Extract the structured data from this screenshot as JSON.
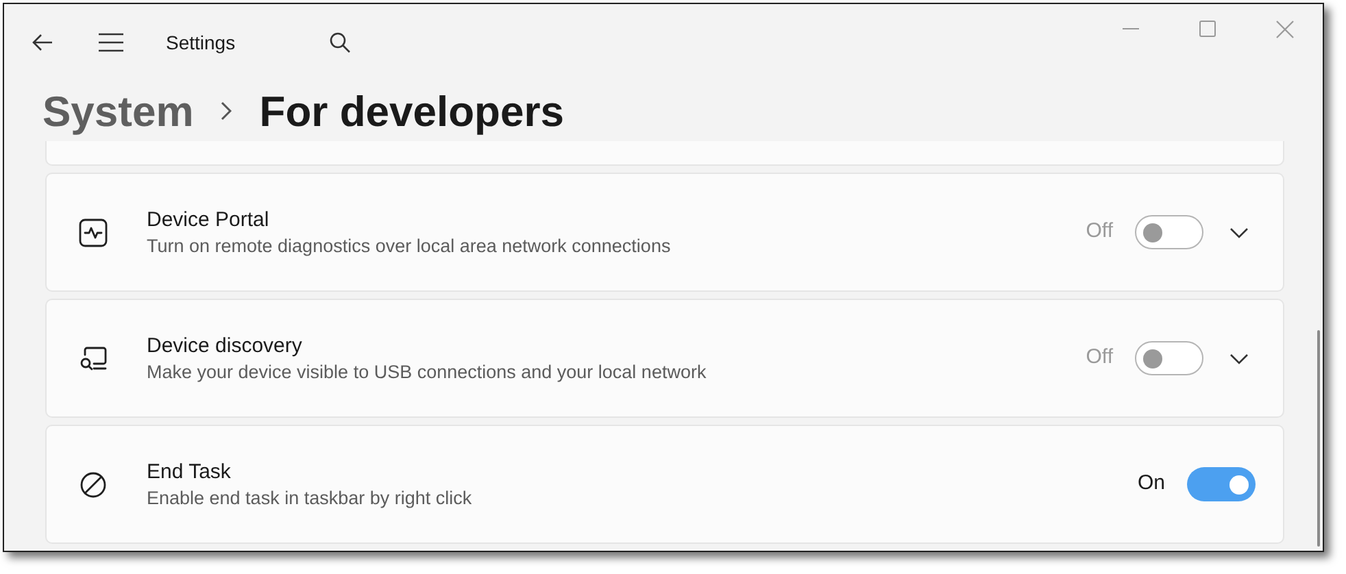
{
  "window": {
    "title": "Settings"
  },
  "breadcrumb": [
    {
      "label": "System",
      "current": false
    },
    {
      "label": "For developers",
      "current": true
    }
  ],
  "settings": [
    {
      "kind": "pulse",
      "title": "Device Portal",
      "description": "Turn on remote diagnostics over local area network connections",
      "state_text": "Off",
      "on": false,
      "expandable": true
    },
    {
      "kind": "discovery",
      "title": "Device discovery",
      "description": "Make your device visible to USB connections and your local network",
      "state_text": "Off",
      "on": false,
      "expandable": true
    },
    {
      "kind": "blocked",
      "title": "End Task",
      "description": "Enable end task in taskbar by right click",
      "state_text": "On",
      "on": true,
      "expandable": false
    }
  ]
}
